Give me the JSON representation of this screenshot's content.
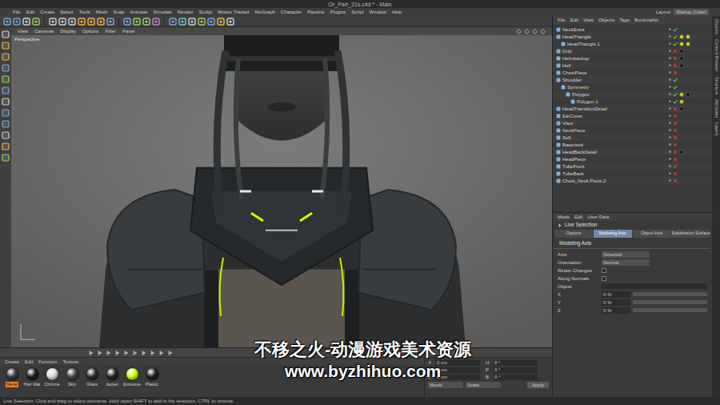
{
  "window": {
    "title": "Or_Part_21s.c4d * - Main"
  },
  "menu": [
    "File",
    "Edit",
    "Create",
    "Select",
    "Tools",
    "Mesh",
    "Snap",
    "Animate",
    "Simulate",
    "Render",
    "Sculpt",
    "Motion Tracker",
    "MoGraph",
    "Character",
    "Pipeline",
    "Plugins",
    "Script",
    "Window",
    "Help"
  ],
  "layout": {
    "label": "Layout:",
    "value": "Startup (User)"
  },
  "viewport": {
    "menu": [
      "View",
      "Cameras",
      "Display",
      "Options",
      "Filter",
      "Panel"
    ],
    "camera": "Perspective"
  },
  "objects": {
    "menu": [
      "File",
      "Edit",
      "View",
      "Objects",
      "Tags",
      "Bookmarks"
    ],
    "items": [
      {
        "name": "NeckExtra",
        "depth": 0,
        "enabled": true,
        "tags": []
      },
      {
        "name": "HeadTriangle",
        "depth": 0,
        "enabled": true,
        "tags": [
          "#e0e000",
          "#e0e000"
        ]
      },
      {
        "name": "HeadTriangle.1",
        "depth": 1,
        "enabled": true,
        "tags": [
          "#e0e000",
          "#e0e000"
        ]
      },
      {
        "name": "Grid",
        "depth": 0,
        "enabled": false,
        "tags": [
          "#111111"
        ]
      },
      {
        "name": "Helmbackup",
        "depth": 0,
        "enabled": false,
        "tags": [
          "#111111"
        ]
      },
      {
        "name": "Hell",
        "depth": 0,
        "enabled": false,
        "tags": [
          "#111111"
        ]
      },
      {
        "name": "ChestPiece",
        "depth": 0,
        "enabled": false,
        "tags": []
      },
      {
        "name": "Shoulder",
        "depth": 0,
        "enabled": true,
        "tags": []
      },
      {
        "name": "Symmetry",
        "depth": 1,
        "enabled": true,
        "tags": []
      },
      {
        "name": "Polygon",
        "depth": 2,
        "enabled": true,
        "tags": [
          "#e0e000",
          "#111111"
        ]
      },
      {
        "name": "Polygon.1",
        "depth": 3,
        "enabled": true,
        "tags": [
          "#e0e000"
        ]
      },
      {
        "name": "HeadTransitionDetail",
        "depth": 0,
        "enabled": false,
        "tags": [
          "#111111"
        ]
      },
      {
        "name": "EarCover",
        "depth": 0,
        "enabled": false,
        "tags": []
      },
      {
        "name": "Visor",
        "depth": 0,
        "enabled": false,
        "tags": []
      },
      {
        "name": "NeckPiece",
        "depth": 0,
        "enabled": false,
        "tags": []
      },
      {
        "name": "Soft",
        "depth": 0,
        "enabled": false,
        "tags": []
      },
      {
        "name": "Baseneck",
        "depth": 0,
        "enabled": false,
        "tags": []
      },
      {
        "name": "HeadBackDetail",
        "depth": 0,
        "enabled": false,
        "tags": [
          "#111111"
        ]
      },
      {
        "name": "HeadPiece",
        "depth": 0,
        "enabled": false,
        "tags": []
      },
      {
        "name": "TubeFront",
        "depth": 0,
        "enabled": false,
        "tags": []
      },
      {
        "name": "TubeBack",
        "depth": 0,
        "enabled": false,
        "tags": []
      },
      {
        "name": "Chest_Neck Piece.2",
        "depth": 0,
        "enabled": false,
        "tags": []
      }
    ]
  },
  "attributes": {
    "menu": [
      "Mode",
      "Edit",
      "User Data"
    ],
    "tool": "Live Selection",
    "tabs": [
      {
        "label": "Options",
        "selected": false
      },
      {
        "label": "Modeling Axis",
        "selected": true
      },
      {
        "label": "Object Axis",
        "selected": false
      },
      {
        "label": "Subdivision Surface",
        "selected": false
      }
    ],
    "section": "Modeling Axis",
    "fields": [
      {
        "kind": "dropdown",
        "label": "Axis",
        "value": "Selected"
      },
      {
        "kind": "dropdown",
        "label": "Orientation",
        "value": "Normal"
      },
      {
        "kind": "checkbox",
        "label": "Retain Changes",
        "checked": false
      },
      {
        "kind": "checkbox",
        "label": "Along Normals",
        "checked": false
      },
      {
        "kind": "field",
        "label": "Object"
      },
      {
        "kind": "slider",
        "label": "X",
        "value": "0 %",
        "level": 0
      },
      {
        "kind": "slider",
        "label": "Y",
        "value": "0 %",
        "level": 0
      },
      {
        "kind": "slider",
        "label": "Z",
        "value": "0 %",
        "level": 0
      }
    ]
  },
  "materials": {
    "menu": [
      "Create",
      "Edit",
      "Function",
      "Texture"
    ],
    "items": [
      {
        "name": "Metal",
        "color": "#3a3a3a",
        "selected": true
      },
      {
        "name": "Hair Mat",
        "color": "#1c1c1c",
        "selected": false
      },
      {
        "name": "Chrome",
        "color": "#d8d8d8",
        "selected": false
      },
      {
        "name": "Skin",
        "color": "#4a4340",
        "selected": false
      },
      {
        "name": "Glass",
        "color": "#2a2a2a",
        "selected": false
      },
      {
        "name": "Jacket",
        "color": "#252525",
        "selected": false
      },
      {
        "name": "Emissive",
        "color": "#c8ff00",
        "selected": false
      },
      {
        "name": "Plastic",
        "color": "#202020",
        "selected": false
      }
    ]
  },
  "coordinates": {
    "rows": [
      {
        "axis": "X",
        "value": "0 cm",
        "axis2": "H",
        "value2": "0 °"
      },
      {
        "axis": "Y",
        "value": "0 cm",
        "axis2": "P",
        "value2": "0 °"
      },
      {
        "axis": "Z",
        "value": "0 cm",
        "axis2": "B",
        "value2": "0 °"
      }
    ],
    "dropdowns": [
      "World",
      "Scale"
    ],
    "apply": "Apply"
  },
  "side_tabs": [
    "Objects",
    "Content Browser",
    "Structure",
    "Attributes",
    "Layers"
  ],
  "status": "Live Selection: Click and drag to select elements. Hold down SHIFT to add to the selection, CTRL to remove.",
  "watermark": {
    "title": "不移之火-动漫游戏美术资源",
    "url": "www.byzhihuo.com"
  }
}
